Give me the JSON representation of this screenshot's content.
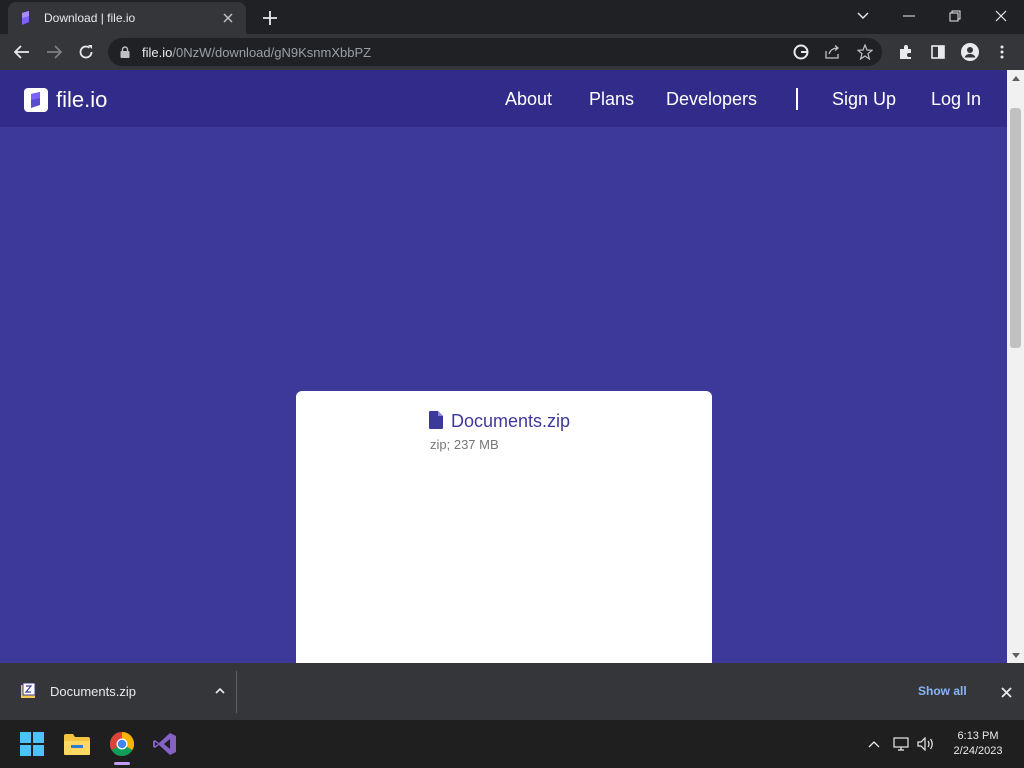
{
  "browser": {
    "tab_title": "Download | file.io",
    "url_host": "file.io",
    "url_path": "/0NzW/download/gN9KsnmXbbPZ"
  },
  "site": {
    "brand": "file.io",
    "nav": {
      "about": "About",
      "plans": "Plans",
      "developers": "Developers",
      "sign_up": "Sign Up",
      "log_in": "Log In"
    },
    "colors": {
      "page_bg": "#3d399b",
      "nav_bg": "#312c89"
    }
  },
  "file": {
    "name": "Documents.zip",
    "meta": "zip; 237 MB"
  },
  "downloads": {
    "item_name": "Documents.zip",
    "show_all": "Show all"
  },
  "taskbar": {
    "time": "6:13 PM",
    "date": "2/24/2023",
    "apps": [
      "start-icon",
      "file-explorer-icon",
      "chrome-icon",
      "visual-studio-icon"
    ]
  }
}
